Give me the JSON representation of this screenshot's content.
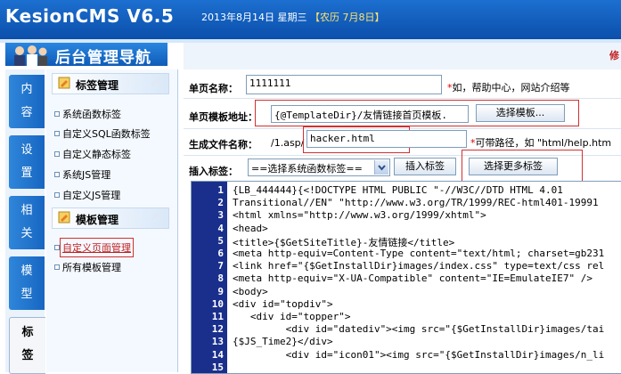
{
  "app": {
    "logo": "KesionCMS V6.5",
    "date": "2013年8月14日 星期三",
    "lunar": "【农历 7月8日】"
  },
  "nav": {
    "title": "后台管理导航",
    "tabs": [
      {
        "label": "内容"
      },
      {
        "label": "设置"
      },
      {
        "label": "相关"
      },
      {
        "label": "模型"
      },
      {
        "label": "标签"
      }
    ],
    "groups": [
      {
        "title": "标签管理",
        "items": [
          "系统函数标签",
          "自定义SQL函数标签",
          "自定义静态标签",
          "系统JS管理",
          "自定义JS管理"
        ]
      },
      {
        "title": "模板管理",
        "items": [
          "自定义页面管理",
          "所有模板管理"
        ]
      }
    ]
  },
  "form": {
    "top_notice": "修",
    "page_name_label": "单页名称：",
    "page_name_value": "1111111",
    "page_name_note_star": "*",
    "page_name_note": "如，帮助中心，网站介绍等",
    "template_label": "单页模板地址：",
    "template_value": "{@TemplateDir}/友情链接首页模板.",
    "choose_template_button": "选择模板...",
    "filename_label": "生成文件名称：",
    "filename_prefix": "/1.asp/",
    "filename_value": "hacker.html",
    "filename_note_star": "*",
    "filename_note": "可带路径，如 \"html/help.htm",
    "insert_label": "插入标签：",
    "select_value": "==选择系统函数标签==",
    "insert_button": "插入标签",
    "more_tags_button": "选择更多标签"
  },
  "editor": {
    "line_numbers": [
      "1",
      "2",
      "3",
      "4",
      "5",
      "6",
      "7",
      "8",
      "9",
      "10",
      "11",
      "12",
      "13",
      "14",
      "15"
    ],
    "lines": [
      "{LB_444444}{<!DOCTYPE HTML PUBLIC \"-//W3C//DTD HTML 4.01",
      "Transitional//EN\" \"http://www.w3.org/TR/1999/REC-html401-19991",
      "<html xmlns=\"http://www.w3.org/1999/xhtml\">",
      "<head>",
      "<title>{$GetSiteTitle}-友情链接</title>",
      "<meta http-equiv=Content-Type content=\"text/html; charset=gb231",
      "<link href=\"{$GetInstallDir}images/index.css\" type=text/css rel",
      "<meta http-equiv=\"X-UA-Compatible\" content=\"IE=EmulateIE7\" />",
      "<body>",
      "<div id=\"topdiv\">",
      "   <div id=\"topper\">",
      "         <div id=\"datediv\"><img src=\"{$GetInstallDir}images/tai",
      "{$JS_Time2}</div>",
      "         <div id=\"icon01\"><img src=\"{$GetInstallDir}images/n_li",
      ""
    ]
  },
  "colors": {
    "topbar": "#0b4fab",
    "gutter": "#1a2f8c",
    "highlight": "#d23030"
  }
}
